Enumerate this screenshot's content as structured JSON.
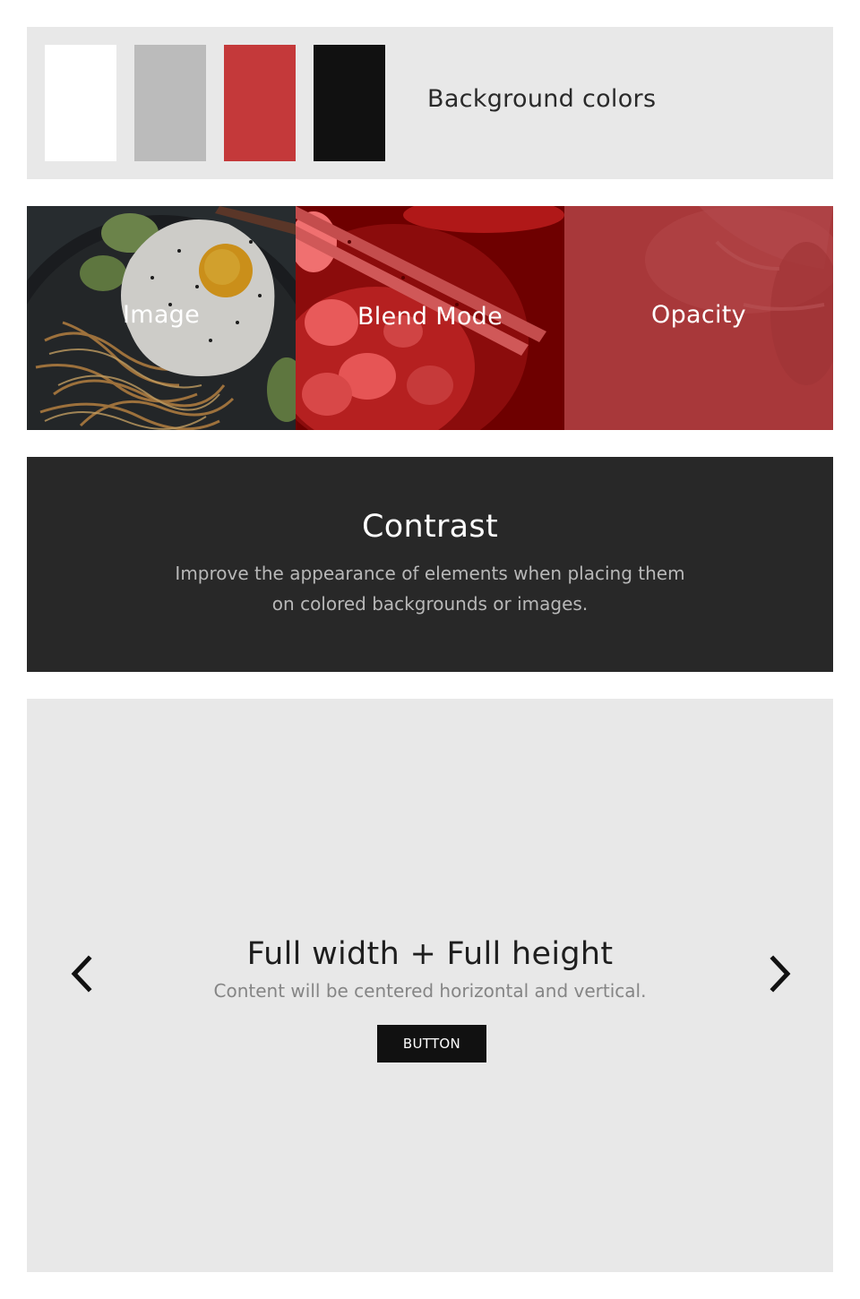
{
  "colors": {
    "page_bg": "#ffffff",
    "panel_bg": "#e8e8e8",
    "dark_panel_bg": "#282828",
    "accent_red": "#c4393a",
    "button_bg": "#111111"
  },
  "swatches": {
    "colors": [
      "#ffffff",
      "#bbbbbb",
      "#c4393a",
      "#111111"
    ],
    "label": "Background colors"
  },
  "image_strip": {
    "tiles": [
      {
        "label": "Image",
        "treatment": "image"
      },
      {
        "label": "Blend Mode",
        "treatment": "red-multiply"
      },
      {
        "label": "Opacity",
        "treatment": "red-overlay"
      }
    ]
  },
  "contrast": {
    "title": "Contrast",
    "text_line1": "Improve the appearance of elements when placing them",
    "text_line2": "on colored backgrounds or images."
  },
  "slider": {
    "title": "Full width + Full height",
    "subtitle": "Content will be centered horizontal and vertical.",
    "button_label": "BUTTON",
    "prev_icon": "chevron-left-icon",
    "next_icon": "chevron-right-icon"
  }
}
